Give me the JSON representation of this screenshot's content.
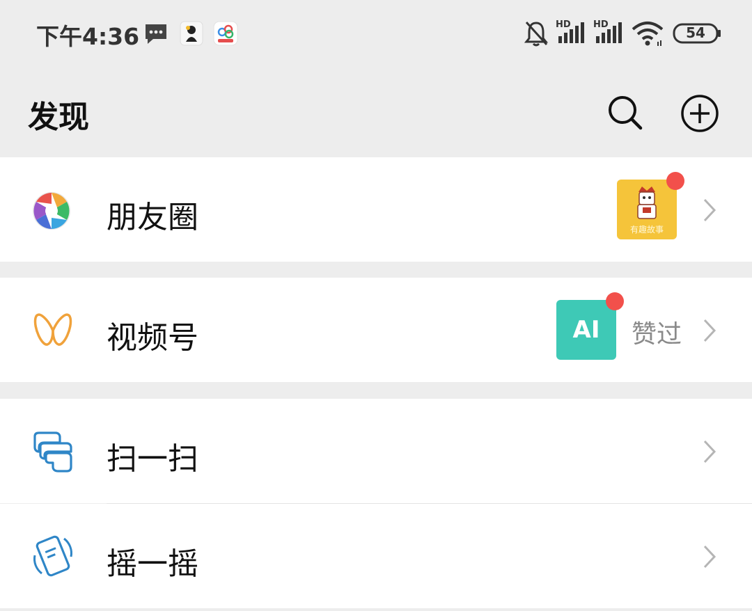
{
  "status_bar": {
    "time": "下午4:36",
    "battery": "54",
    "signal_label_1": "HD",
    "signal_label_2": "HD",
    "icons": [
      "message-icon",
      "app-notification-icon",
      "cloud-app-icon",
      "bell-muted-icon",
      "signal-icon",
      "signal-icon",
      "wifi-icon",
      "battery-icon"
    ]
  },
  "header": {
    "title": "发现",
    "actions": [
      "search-icon",
      "add-circle-icon"
    ]
  },
  "menu": {
    "moments": {
      "label": "朋友圈",
      "icon": "moments-aperture-icon",
      "thumb_caption": "有趣故事"
    },
    "channels": {
      "label": "视频号",
      "icon": "channels-icon",
      "thumb_text": "AI",
      "status": "赞过"
    },
    "scan": {
      "label": "扫一扫",
      "icon": "scan-icon"
    },
    "shake": {
      "label": "摇一摇",
      "icon": "shake-icon"
    }
  },
  "colors": {
    "background": "#ededed",
    "row": "#ffffff",
    "badge_red": "#f2504b",
    "channels_orange": "#f0a23b",
    "scan_blue": "#2f86c7",
    "ai_teal": "#3ec9b6",
    "thumb_yellow": "#f5c43a"
  }
}
